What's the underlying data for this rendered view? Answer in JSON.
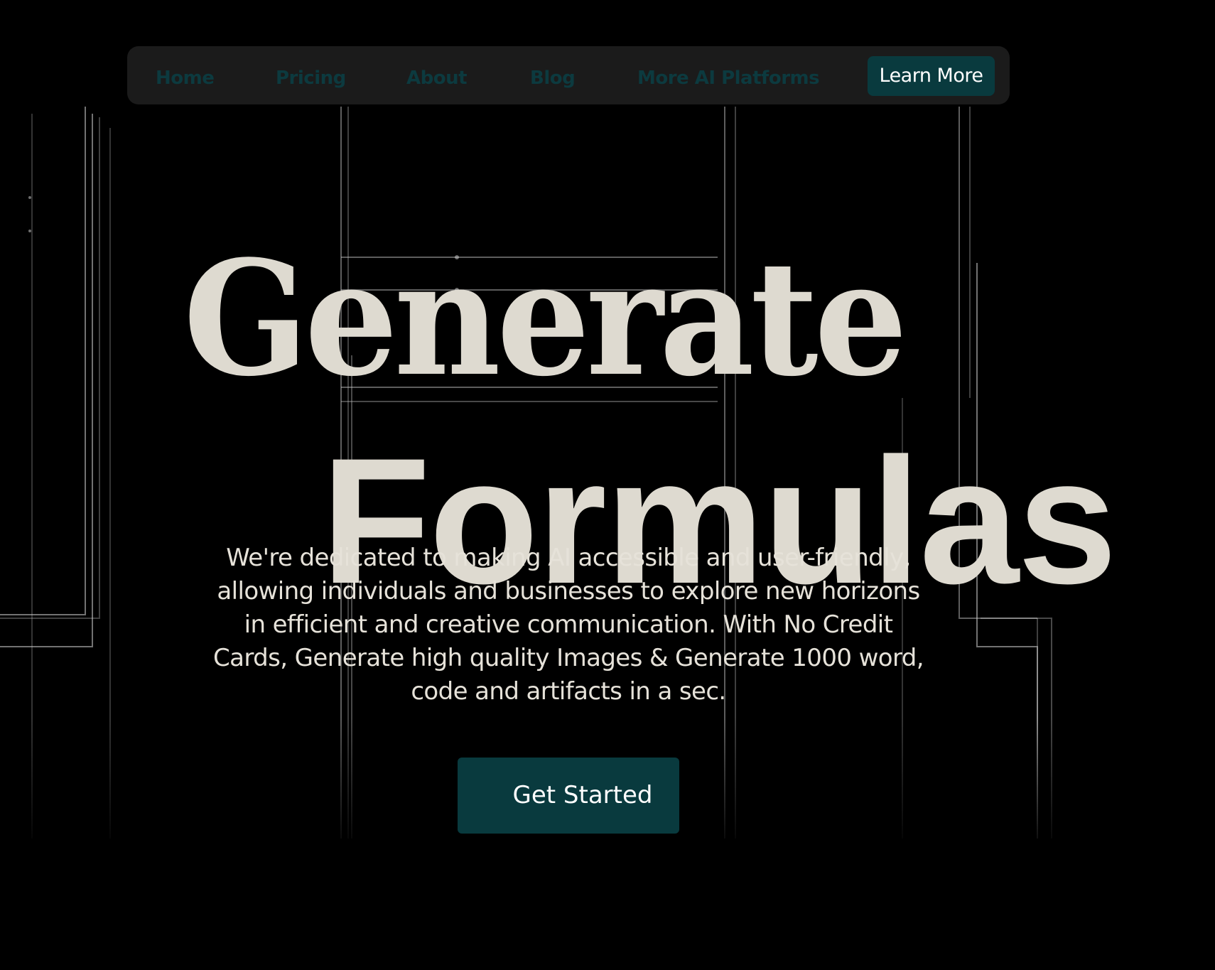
{
  "nav": {
    "items": [
      {
        "label": "Home"
      },
      {
        "label": "Pricing"
      },
      {
        "label": "About"
      },
      {
        "label": "Blog"
      },
      {
        "label": "More AI Platforms"
      }
    ],
    "cta_label": "Learn More"
  },
  "hero": {
    "title_line1": "Generate",
    "title_line2": "Formulas",
    "description": "We're dedicated to making AI accessible and user-friendly, allowing individuals and businesses to explore new horizons in efficient and creative communication. With No Credit Cards, Generate high quality Images & Generate 1000 word, code and artifacts in a sec.",
    "cta_label": "Get Started"
  },
  "colors": {
    "background": "#000000",
    "nav_background": "#1b1b1b",
    "accent": "#093a3e",
    "nav_link": "#0c3a3f",
    "hero_text": "#dedad0"
  }
}
